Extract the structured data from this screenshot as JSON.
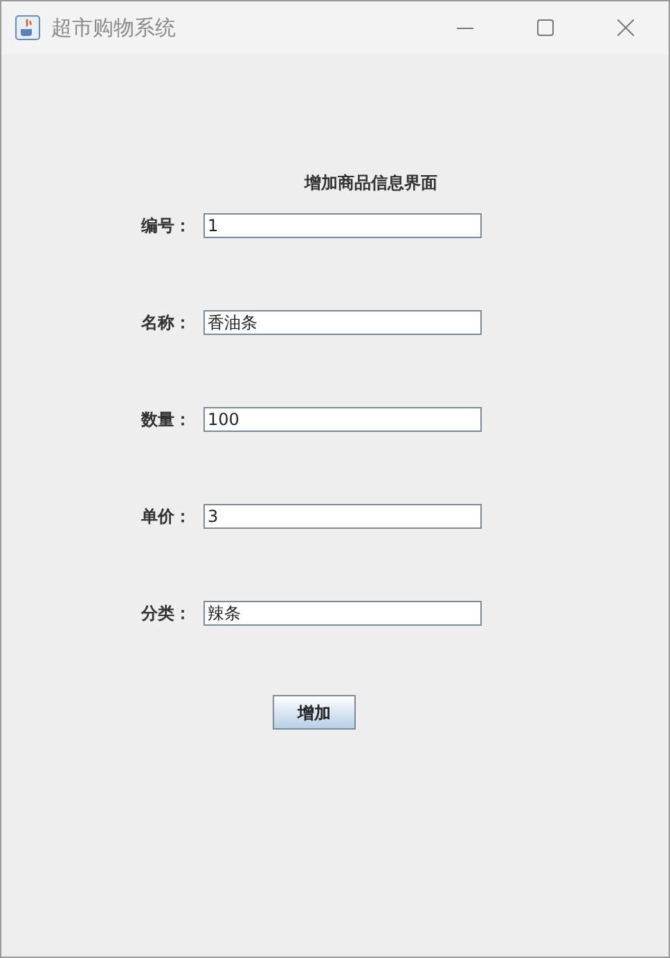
{
  "window": {
    "title": "超市购物系统"
  },
  "heading": "增加商品信息界面",
  "fields": [
    {
      "label": "编号：",
      "value": "1"
    },
    {
      "label": "名称：",
      "value": "香油条"
    },
    {
      "label": "数量：",
      "value": "100"
    },
    {
      "label": "单价：",
      "value": "3"
    },
    {
      "label": "分类：",
      "value": "辣条"
    }
  ],
  "button": "增加"
}
